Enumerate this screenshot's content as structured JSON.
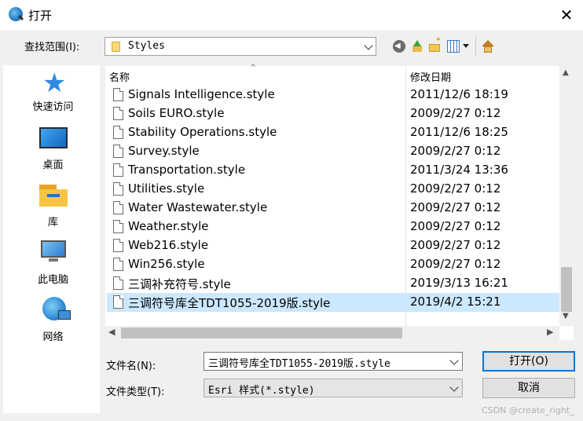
{
  "window": {
    "title": "打开",
    "close_glyph": "✕"
  },
  "look_in": {
    "label": "查找范围(I):",
    "value": "Styles"
  },
  "toolbar": {
    "icons": [
      "back-icon",
      "up-folder-icon",
      "new-folder-icon",
      "view-menu-icon",
      "home-icon"
    ]
  },
  "places": [
    {
      "label": "快速访问",
      "icon": "quick-access-star-icon"
    },
    {
      "label": "桌面",
      "icon": "desktop-icon"
    },
    {
      "label": "库",
      "icon": "library-icon"
    },
    {
      "label": "此电脑",
      "icon": "computer-icon"
    },
    {
      "label": "网络",
      "icon": "network-icon"
    }
  ],
  "file_list": {
    "columns": {
      "name": "名称",
      "date": "修改日期"
    },
    "sort_indicator": "^",
    "rows": [
      {
        "name": "Signals Intelligence.style",
        "date": "2011/12/6 18:19"
      },
      {
        "name": "Soils EURO.style",
        "date": "2009/2/27 0:12"
      },
      {
        "name": "Stability Operations.style",
        "date": "2011/12/6 18:25"
      },
      {
        "name": "Survey.style",
        "date": "2009/2/27 0:12"
      },
      {
        "name": "Transportation.style",
        "date": "2011/3/24 13:36"
      },
      {
        "name": "Utilities.style",
        "date": "2009/2/27 0:12"
      },
      {
        "name": "Water Wastewater.style",
        "date": "2009/2/27 0:12"
      },
      {
        "name": "Weather.style",
        "date": "2009/2/27 0:12"
      },
      {
        "name": "Web216.style",
        "date": "2009/2/27 0:12"
      },
      {
        "name": "Win256.style",
        "date": "2009/2/27 0:12"
      },
      {
        "name": "三调补充符号.style",
        "date": "2019/3/13 16:21"
      },
      {
        "name": "三调符号库全TDT1055-2019版.style",
        "date": "2019/4/2 15:21",
        "selected": true
      }
    ]
  },
  "filename": {
    "label": "文件名(N):",
    "value": "三调符号库全TDT1055-2019版.style"
  },
  "filetype": {
    "label": "文件类型(T):",
    "value": "Esri 样式(*.style)"
  },
  "buttons": {
    "open": "打开(O)",
    "cancel": "取消"
  },
  "watermark": "CSDN @create_right_",
  "colors": {
    "selection": "#cce8ff",
    "default_button_border": "#0078d7"
  }
}
